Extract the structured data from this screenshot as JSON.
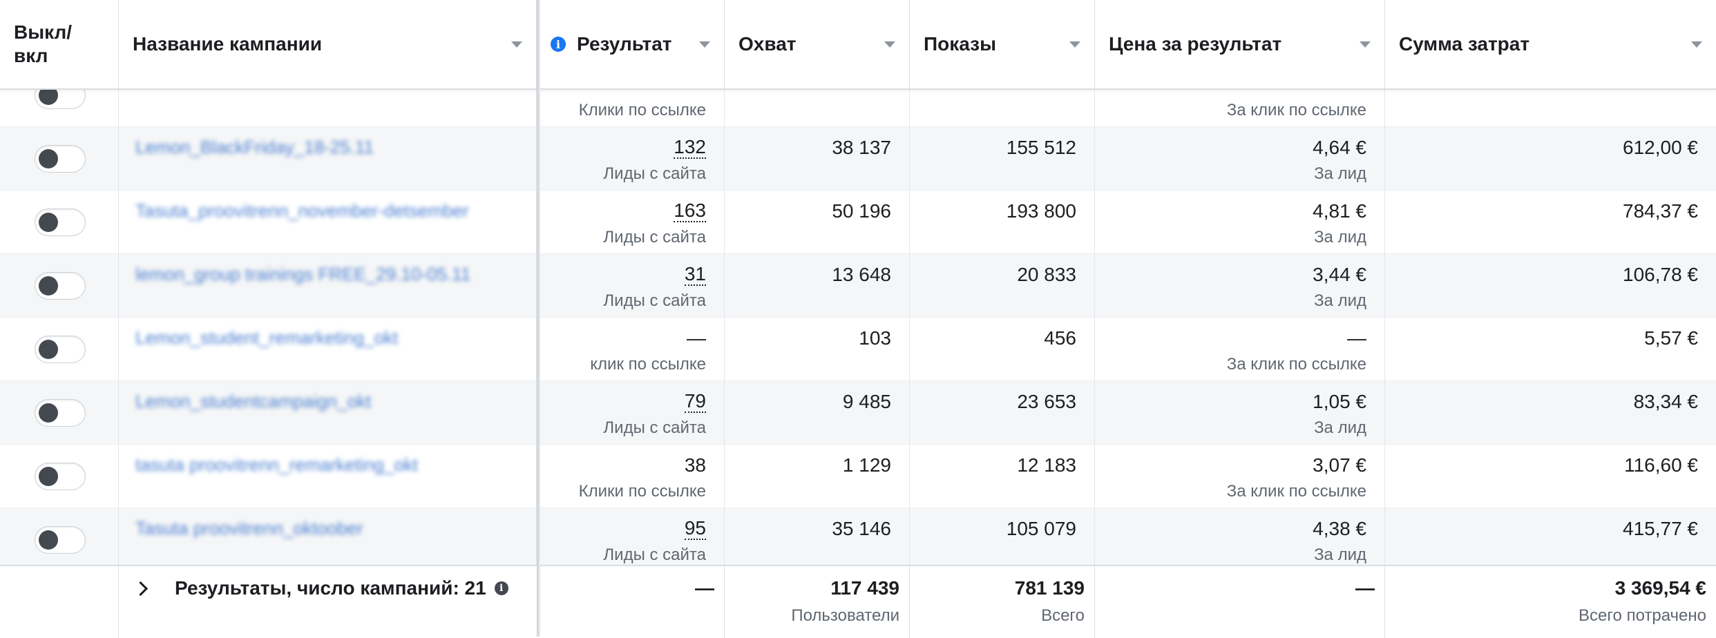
{
  "header": {
    "toggle_label": "Выкл/\nвкл",
    "name": "Название кампании",
    "result": "Результат",
    "reach": "Охват",
    "impressions": "Показы",
    "cost_per_result": "Цена за результат",
    "spend": "Сумма затрат"
  },
  "partial_row": {
    "result_sub": "Клики по ссылке",
    "cpr_sub": "За клик по ссылке"
  },
  "rows": [
    {
      "name": "Lemon_BlackFriday_18-25.11",
      "result": "132",
      "result_sub": "Лиды с сайта",
      "reach": "38 137",
      "impressions": "155 512",
      "cpr": "4,64 €",
      "cpr_sub": "За лид",
      "spend": "612,00 €"
    },
    {
      "name": "Tasuta_proovitrenn_november-detsember",
      "result": "163",
      "result_sub": "Лиды с сайта",
      "reach": "50 196",
      "impressions": "193 800",
      "cpr": "4,81 €",
      "cpr_sub": "За лид",
      "spend": "784,37 €"
    },
    {
      "name": "lemon_group trainings FREE_29.10-05.11",
      "result": "31",
      "result_sub": "Лиды с сайта",
      "reach": "13 648",
      "impressions": "20 833",
      "cpr": "3,44 €",
      "cpr_sub": "За лид",
      "spend": "106,78 €"
    },
    {
      "name": "Lemon_student_remarketing_okt",
      "result": "—",
      "result_sub": "клик по ссылке",
      "reach": "103",
      "impressions": "456",
      "cpr": "—",
      "cpr_sub": "За клик по ссылке",
      "spend": "5,57 €"
    },
    {
      "name": "Lemon_studentcampaign_okt",
      "result": "79",
      "result_sub": "Лиды с сайта",
      "reach": "9 485",
      "impressions": "23 653",
      "cpr": "1,05 €",
      "cpr_sub": "За лид",
      "spend": "83,34 €"
    },
    {
      "name": "tasuta proovitrenn_remarketing_okt",
      "result": "38",
      "result_sub": "Клики по ссылке",
      "reach": "1 129",
      "impressions": "12 183",
      "cpr": "3,07 €",
      "cpr_sub": "За клик по ссылке",
      "spend": "116,60 €"
    },
    {
      "name": "Tasuta proovitrenn_oktoober",
      "result": "95",
      "result_sub": "Лиды с сайта",
      "reach": "35 146",
      "impressions": "105 079",
      "cpr": "4,38 €",
      "cpr_sub": "За лид",
      "spend": "415,77 €"
    }
  ],
  "footer": {
    "label": "Результаты, число кампаний: 21",
    "result": "—",
    "reach": "117 439",
    "reach_sub": "Пользователи",
    "impressions": "781 139",
    "impressions_sub": "Всего",
    "cpr": "—",
    "spend": "3 369,54 €",
    "spend_sub": "Всего потрачено"
  },
  "colors": {
    "accent": "#1877f2",
    "row_alt": "#f5f6f7",
    "subtext": "#606770"
  },
  "icons": [
    "info-icon",
    "sort-caret-icon",
    "chevron-right-icon",
    "toggle-switch"
  ]
}
